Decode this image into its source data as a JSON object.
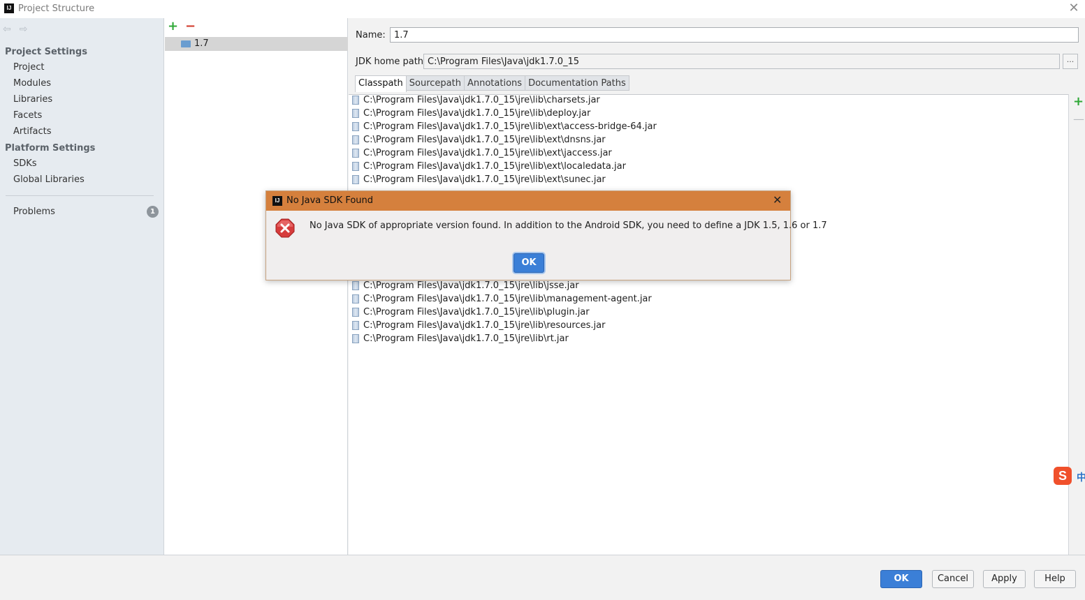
{
  "window": {
    "title": "Project Structure",
    "logo_text": "IJ",
    "close_glyph": "✕"
  },
  "nav": {
    "back_glyph": "⇦",
    "forward_glyph": "⇨",
    "project_settings_header": "Project Settings",
    "project_settings_items": [
      "Project",
      "Modules",
      "Libraries",
      "Facets",
      "Artifacts"
    ],
    "platform_settings_header": "Platform Settings",
    "platform_settings_items": [
      "SDKs",
      "Global Libraries"
    ],
    "problems_label": "Problems",
    "problems_count": "1"
  },
  "sdk_list": {
    "add_glyph": "+",
    "remove_glyph": "−",
    "selected_sdk": "1.7"
  },
  "detail": {
    "name_label": "Name:",
    "name_value": "1.7",
    "jdk_home_label": "JDK home path:",
    "jdk_home_value": "C:\\Program Files\\Java\\jdk1.7.0_15",
    "browse_label": "...",
    "tabs": [
      "Classpath",
      "Sourcepath",
      "Annotations",
      "Documentation Paths"
    ],
    "active_tab": "Classpath",
    "classpath_entries": [
      "C:\\Program Files\\Java\\jdk1.7.0_15\\jre\\lib\\charsets.jar",
      "C:\\Program Files\\Java\\jdk1.7.0_15\\jre\\lib\\deploy.jar",
      "C:\\Program Files\\Java\\jdk1.7.0_15\\jre\\lib\\ext\\access-bridge-64.jar",
      "C:\\Program Files\\Java\\jdk1.7.0_15\\jre\\lib\\ext\\dnsns.jar",
      "C:\\Program Files\\Java\\jdk1.7.0_15\\jre\\lib\\ext\\jaccess.jar",
      "C:\\Program Files\\Java\\jdk1.7.0_15\\jre\\lib\\ext\\localedata.jar",
      "C:\\Program Files\\Java\\jdk1.7.0_15\\jre\\lib\\ext\\sunec.jar",
      "C:\\Program Files\\Java\\jdk1.7.0_15\\jre\\lib\\jsse.jar",
      "C:\\Program Files\\Java\\jdk1.7.0_15\\jre\\lib\\management-agent.jar",
      "C:\\Program Files\\Java\\jdk1.7.0_15\\jre\\lib\\plugin.jar",
      "C:\\Program Files\\Java\\jdk1.7.0_15\\jre\\lib\\resources.jar",
      "C:\\Program Files\\Java\\jdk1.7.0_15\\jre\\lib\\rt.jar"
    ],
    "cp_add_glyph": "+",
    "cp_remove_glyph": "—",
    "ime_logo": "S",
    "ime_zh": "中"
  },
  "footer": {
    "ok": "OK",
    "cancel": "Cancel",
    "apply": "Apply",
    "help": "Help"
  },
  "dialog": {
    "title": "No Java SDK Found",
    "logo_text": "IJ",
    "close_glyph": "✕",
    "message": "No Java SDK of appropriate version found. In addition to the Android SDK, you need to define a JDK 1.5, 1.6 or 1.7",
    "ok": "OK"
  },
  "colors": {
    "accent": "#3b7fd7",
    "dialog_title_bg": "#d5803d",
    "nav_bg": "#e6ebf0",
    "add_green": "#2ea836",
    "remove_red": "#d1392b",
    "error_red": "#d63b3b"
  }
}
